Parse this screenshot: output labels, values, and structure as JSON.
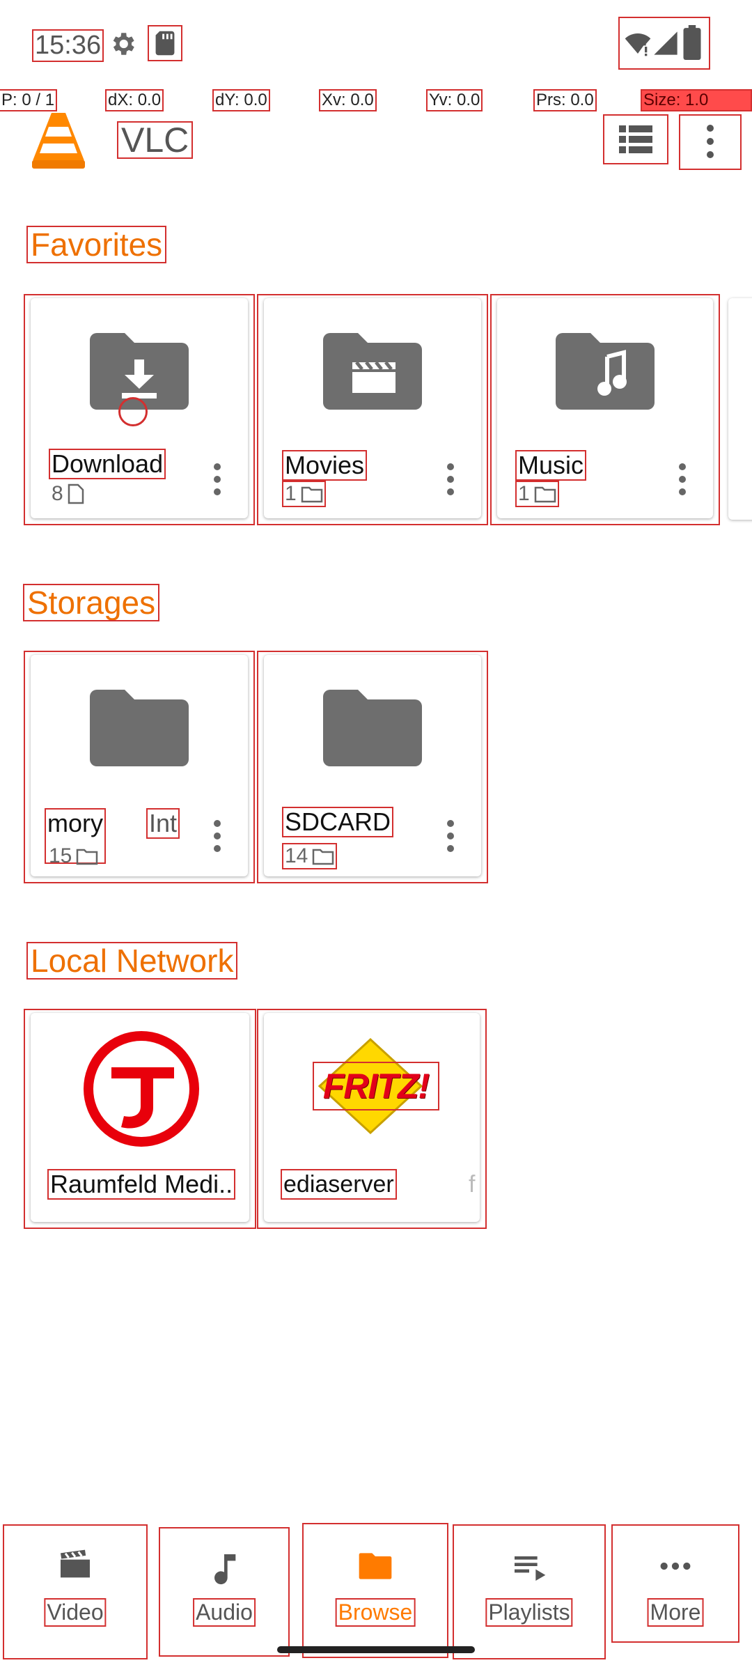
{
  "status_bar": {
    "time": "15:36",
    "icons": [
      "gear-icon",
      "sd-card-icon",
      "wifi-icon",
      "signal-icon",
      "battery-icon"
    ]
  },
  "pointer_overlay": {
    "p": "P: 0 / 1",
    "dx": "dX: 0.0",
    "dy": "dY: 0.0",
    "xv": "Xv: 0.0",
    "yv": "Yv: 0.0",
    "prs": "Prs: 0.0",
    "size": "Size: 1.0"
  },
  "app_bar": {
    "title": "VLC",
    "icons": [
      "vlc-cone-icon",
      "list-view-icon",
      "more-vert-icon"
    ]
  },
  "sections": {
    "favorites": {
      "title": "Favorites",
      "items": [
        {
          "name": "Download",
          "count": "8",
          "icon": "download-folder-icon",
          "count_icon": "file-icon"
        },
        {
          "name": "Movies",
          "count": "1",
          "icon": "movies-folder-icon",
          "count_icon": "folder-icon"
        },
        {
          "name": "Music",
          "count": "1",
          "icon": "music-folder-icon",
          "count_icon": "folder-icon"
        }
      ]
    },
    "storages": {
      "title": "Storages",
      "items": [
        {
          "name_left": "mory",
          "name_right": "Int",
          "count": "15",
          "icon": "folder-icon",
          "count_icon": "folder-icon"
        },
        {
          "name": "SDCARD",
          "count": "14",
          "icon": "folder-icon",
          "count_icon": "folder-icon"
        }
      ]
    },
    "local_network": {
      "title": "Local Network",
      "items": [
        {
          "name": "Raumfeld Medi..",
          "icon": "raumfeld-logo"
        },
        {
          "name": "ediaserver",
          "name_faded": "f",
          "icon": "fritz-logo",
          "logo_text": "FRITZ!"
        }
      ]
    }
  },
  "bottom_nav": {
    "items": [
      {
        "label": "Video",
        "icon": "video-icon"
      },
      {
        "label": "Audio",
        "icon": "music-note-icon"
      },
      {
        "label": "Browse",
        "icon": "folder-icon"
      },
      {
        "label": "Playlists",
        "icon": "playlist-icon"
      },
      {
        "label": "More",
        "icon": "more-horiz-icon"
      }
    ],
    "active": "Browse"
  },
  "colors": {
    "accent": "#ee7000",
    "icon_gray": "#6e6e6e",
    "annotation_red": "#d32f2f"
  }
}
